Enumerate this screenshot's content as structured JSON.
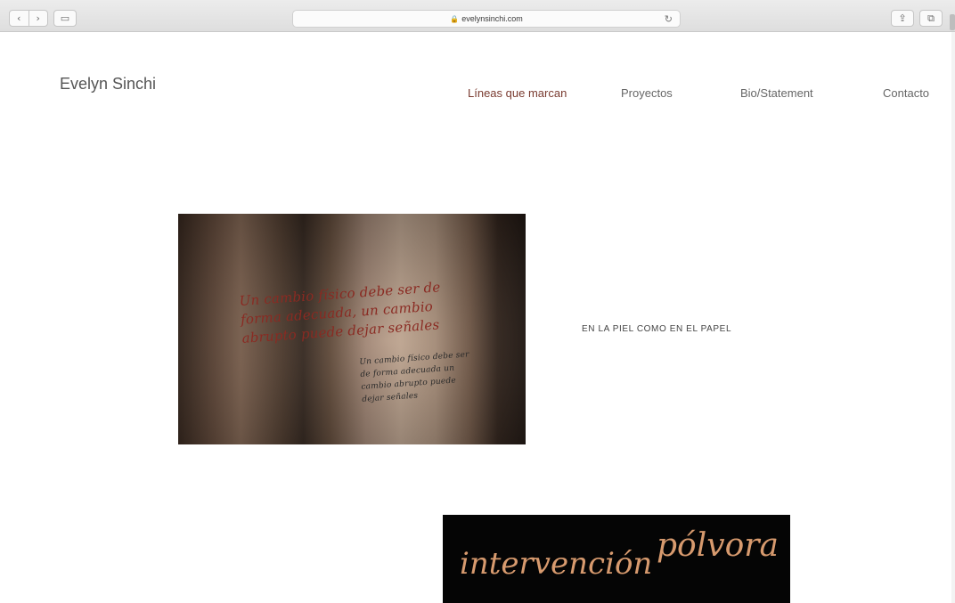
{
  "browser": {
    "url": "evelynsinchi.com",
    "back_glyph": "‹",
    "forward_glyph": "›",
    "sidebar_glyph": "▭",
    "reload_glyph": "↻",
    "share_glyph": "⇪",
    "tabs_glyph": "⧉",
    "lock_glyph": "🔒"
  },
  "site": {
    "title": "Evelyn Sinchi",
    "nav": [
      {
        "label": "Líneas que marcan",
        "active": true
      },
      {
        "label": "Proyectos",
        "active": false
      },
      {
        "label": "Bio/Statement",
        "active": false
      },
      {
        "label": "Contacto",
        "active": false
      }
    ]
  },
  "projects": [
    {
      "caption": "EN LA PIEL COMO EN EL PAPEL",
      "image_text": "Un cambio físico debe ser de forma adecuada, un cambio abrupto puede dejar señales",
      "image_text_small": "Un cambio físico debe ser de forma adecuada un cambio abrupto puede dejar señales"
    },
    {
      "banner_words": [
        "intervención",
        "pólvora"
      ]
    }
  ],
  "colors": {
    "nav_active": "#7a3b30",
    "banner_text": "#d79a6e",
    "banner_bg": "#050505"
  }
}
